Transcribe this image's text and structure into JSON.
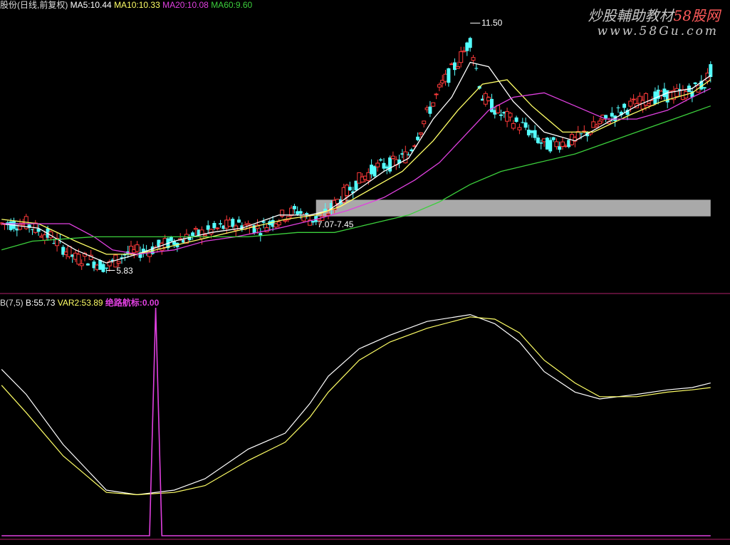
{
  "header": {
    "stock": "股份(日线,前复权)",
    "ma5": "MA5:10.44",
    "ma10": "MA10:10.33",
    "ma20": "MA20:10.08",
    "ma60": "MA60:9.60"
  },
  "watermark": {
    "title_a": "炒股輔助教材",
    "title_b": "58股网",
    "url": "www.58Gu.com"
  },
  "annotations": {
    "high": "11.50",
    "low": "5.83",
    "zone": "7.07-7.45"
  },
  "indicator": {
    "name": "B(7,5)",
    "b": "B:55.73",
    "var2": "VAR2:53.89",
    "signal": "绝路航标:0.00"
  },
  "colors": {
    "up": "#ff3a3a",
    "down": "#54ffff",
    "ma5": "#ffffff",
    "ma10": "#ffff66",
    "ma20": "#e040e0",
    "ma60": "#3ccf3c",
    "divider": "#b0206a",
    "zone": "#a9a9a9"
  },
  "chart_data": [
    {
      "type": "candlestick",
      "x_range": [
        0,
        166
      ],
      "ylim": [
        5.3,
        11.8
      ],
      "moving_averages": [
        "MA5",
        "MA10",
        "MA20",
        "MA60"
      ],
      "price_path": [
        [
          0,
          6.9
        ],
        [
          8,
          6.9
        ],
        [
          16,
          6.6
        ],
        [
          24,
          6.1
        ],
        [
          28,
          6.1
        ],
        [
          34,
          5.9
        ],
        [
          40,
          6.2
        ],
        [
          48,
          6.3
        ],
        [
          56,
          6.5
        ],
        [
          66,
          6.7
        ],
        [
          76,
          6.9
        ],
        [
          84,
          6.8
        ],
        [
          92,
          7.1
        ],
        [
          96,
          7.2
        ],
        [
          100,
          7.0
        ],
        [
          104,
          7.0
        ],
        [
          110,
          7.5
        ],
        [
          116,
          7.9
        ],
        [
          122,
          8.2
        ],
        [
          128,
          8.3
        ],
        [
          132,
          8.5
        ],
        [
          138,
          9.4
        ],
        [
          143,
          10.1
        ],
        [
          148,
          10.6
        ],
        [
          152,
          11.1
        ],
        [
          156,
          9.8
        ],
        [
          162,
          9.4
        ],
        [
          170,
          9.1
        ],
        [
          176,
          8.7
        ],
        [
          186,
          8.8
        ],
        [
          194,
          9.2
        ],
        [
          204,
          9.6
        ],
        [
          212,
          9.8
        ],
        [
          222,
          9.9
        ],
        [
          228,
          10.1
        ],
        [
          230,
          10.4
        ]
      ],
      "ma_paths": {
        "MA5": [
          [
            0,
            6.9
          ],
          [
            12,
            6.8
          ],
          [
            24,
            6.3
          ],
          [
            34,
            6.0
          ],
          [
            44,
            6.2
          ],
          [
            56,
            6.5
          ],
          [
            68,
            6.7
          ],
          [
            78,
            6.8
          ],
          [
            90,
            7.1
          ],
          [
            100,
            7.1
          ],
          [
            106,
            7.2
          ],
          [
            114,
            7.6
          ],
          [
            124,
            8.1
          ],
          [
            132,
            8.4
          ],
          [
            140,
            9.3
          ],
          [
            146,
            9.8
          ],
          [
            152,
            10.6
          ],
          [
            158,
            10.5
          ],
          [
            166,
            9.7
          ],
          [
            176,
            9.0
          ],
          [
            186,
            8.8
          ],
          [
            196,
            9.2
          ],
          [
            206,
            9.6
          ],
          [
            216,
            9.9
          ],
          [
            224,
            10.0
          ],
          [
            230,
            10.3
          ]
        ],
        "MA10": [
          [
            0,
            7.0
          ],
          [
            12,
            6.9
          ],
          [
            24,
            6.5
          ],
          [
            34,
            6.2
          ],
          [
            44,
            6.2
          ],
          [
            56,
            6.4
          ],
          [
            68,
            6.6
          ],
          [
            80,
            6.8
          ],
          [
            92,
            7.0
          ],
          [
            102,
            7.1
          ],
          [
            110,
            7.3
          ],
          [
            120,
            7.7
          ],
          [
            130,
            8.1
          ],
          [
            140,
            8.8
          ],
          [
            148,
            9.5
          ],
          [
            156,
            10.1
          ],
          [
            164,
            10.2
          ],
          [
            172,
            9.6
          ],
          [
            182,
            9.0
          ],
          [
            192,
            9.0
          ],
          [
            204,
            9.4
          ],
          [
            214,
            9.7
          ],
          [
            224,
            9.9
          ],
          [
            230,
            10.2
          ]
        ],
        "MA20": [
          [
            0,
            6.9
          ],
          [
            12,
            6.9
          ],
          [
            22,
            6.9
          ],
          [
            30,
            6.6
          ],
          [
            36,
            6.3
          ],
          [
            44,
            6.2
          ],
          [
            56,
            6.3
          ],
          [
            66,
            6.5
          ],
          [
            76,
            6.6
          ],
          [
            90,
            6.8
          ],
          [
            102,
            7.0
          ],
          [
            112,
            7.2
          ],
          [
            124,
            7.5
          ],
          [
            134,
            7.9
          ],
          [
            142,
            8.3
          ],
          [
            150,
            8.9
          ],
          [
            158,
            9.5
          ],
          [
            166,
            9.8
          ],
          [
            176,
            9.9
          ],
          [
            186,
            9.6
          ],
          [
            196,
            9.3
          ],
          [
            206,
            9.3
          ],
          [
            216,
            9.5
          ],
          [
            224,
            9.8
          ],
          [
            230,
            10.0
          ]
        ],
        "MA60": [
          [
            0,
            6.3
          ],
          [
            10,
            6.5
          ],
          [
            30,
            6.6
          ],
          [
            60,
            6.6
          ],
          [
            80,
            6.6
          ],
          [
            96,
            6.7
          ],
          [
            108,
            6.7
          ],
          [
            120,
            6.9
          ],
          [
            132,
            7.1
          ],
          [
            142,
            7.4
          ],
          [
            152,
            7.8
          ],
          [
            162,
            8.1
          ],
          [
            174,
            8.3
          ],
          [
            186,
            8.5
          ],
          [
            198,
            8.8
          ],
          [
            210,
            9.1
          ],
          [
            222,
            9.4
          ],
          [
            230,
            9.6
          ]
        ]
      },
      "annotations": [
        {
          "text": "11.50",
          "x": 152,
          "y": 11.5
        },
        {
          "text": "5.83",
          "x": 34,
          "y": 5.83
        }
      ],
      "price_zone": {
        "label": "7.07-7.45",
        "low": 7.07,
        "high": 7.45,
        "x_start": 102,
        "x_end": 230
      }
    },
    {
      "type": "line",
      "ylim": [
        0,
        100
      ],
      "series": [
        {
          "name": "B",
          "values": [
            [
              0,
              73
            ],
            [
              8,
              62
            ],
            [
              20,
              40
            ],
            [
              34,
              20
            ],
            [
              44,
              18
            ],
            [
              56,
              20
            ],
            [
              66,
              25
            ],
            [
              80,
              38
            ],
            [
              92,
              45
            ],
            [
              100,
              58
            ],
            [
              106,
              70
            ],
            [
              116,
              82
            ],
            [
              126,
              88
            ],
            [
              138,
              94
            ],
            [
              152,
              97
            ],
            [
              160,
              93
            ],
            [
              168,
              85
            ],
            [
              176,
              72
            ],
            [
              186,
              63
            ],
            [
              194,
              60
            ],
            [
              206,
              62
            ],
            [
              216,
              64
            ],
            [
              224,
              65
            ],
            [
              230,
              67
            ]
          ]
        },
        {
          "name": "VAR2",
          "values": [
            [
              0,
              66
            ],
            [
              8,
              54
            ],
            [
              20,
              35
            ],
            [
              34,
              19
            ],
            [
              44,
              18
            ],
            [
              56,
              19
            ],
            [
              66,
              22
            ],
            [
              80,
              33
            ],
            [
              92,
              41
            ],
            [
              100,
              52
            ],
            [
              106,
              63
            ],
            [
              116,
              77
            ],
            [
              126,
              85
            ],
            [
              138,
              91
            ],
            [
              152,
              96
            ],
            [
              160,
              95
            ],
            [
              168,
              89
            ],
            [
              176,
              77
            ],
            [
              186,
              67
            ],
            [
              194,
              61
            ],
            [
              206,
              61
            ],
            [
              216,
              63
            ],
            [
              224,
              64
            ],
            [
              230,
              65
            ]
          ]
        },
        {
          "name": "绝路航标",
          "values": [
            [
              0,
              0
            ],
            [
              48,
              0
            ],
            [
              50,
              100
            ],
            [
              52,
              0
            ],
            [
              230,
              0
            ]
          ]
        }
      ]
    }
  ]
}
